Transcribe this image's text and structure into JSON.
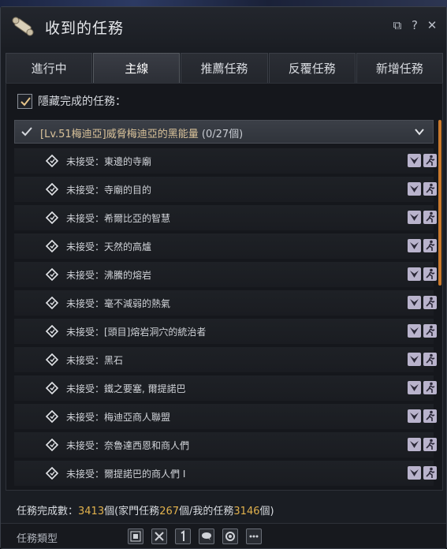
{
  "window": {
    "title": "收到的任務",
    "icon": "scroll-quill-icon"
  },
  "titlebar_buttons": [
    {
      "icon": "restore-icon",
      "glyph": "⧉"
    },
    {
      "icon": "help-icon",
      "glyph": "?"
    },
    {
      "icon": "close-icon",
      "glyph": "✕"
    }
  ],
  "tabs": [
    "進行中",
    "主線",
    "推薦任務",
    "反覆任務",
    "新增任務"
  ],
  "active_tab": "主線",
  "hide_completed": {
    "label": "隱藏完成的任務：",
    "checked": true
  },
  "group": {
    "title": "[Lv.51梅迪亞]威脅梅迪亞的黑能量",
    "count": "(0/27個)",
    "expanded": true
  },
  "quests": [
    "未接受：東邊的寺廟",
    "未接受：寺廟的目的",
    "未接受：希爾比亞的智慧",
    "未接受：天然的高爐",
    "未接受：沸騰的熔岩",
    "未接受：毫不減弱的熱氣",
    "未接受：[頭目]熔岩洞穴的統治者",
    "未接受：黑石",
    "未接受：鐵之要塞, 爾提諾巴",
    "未接受：梅迪亞商人聯盟",
    "未接受：奈魯達西恩和商人們",
    "未接受：爾提諾巴的商人們 I"
  ],
  "footer": {
    "prefix": "任務完成數：",
    "total": "3413",
    "mid1": "個(家門任務",
    "family": "267",
    "mid2": "個/我的任務",
    "mine": "3146",
    "suffix": "個)"
  },
  "type_filter": {
    "label": "任務類型",
    "buttons": [
      "all-types-icon",
      "combat-icon",
      "number-one-icon",
      "chat-icon",
      "gear-icon",
      "more-icon"
    ]
  },
  "colors": {
    "accent": "#e2b24d",
    "group_title": "#d9c29a",
    "scroll": "#c9792c",
    "quest_icon_bg": "#b9b3cc"
  }
}
